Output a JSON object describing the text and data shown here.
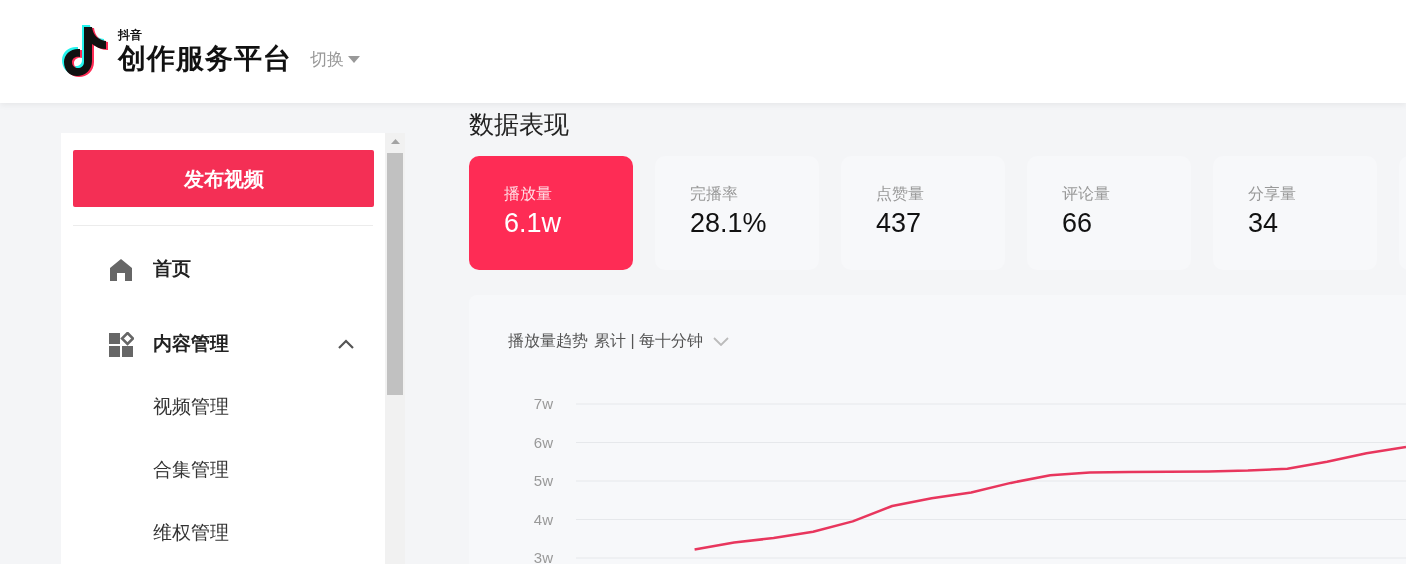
{
  "header": {
    "brand_small": "抖音",
    "brand": "创作服务平台",
    "switch": "切换"
  },
  "sidebar": {
    "publish_button": "发布视频",
    "items": [
      {
        "label": "首页",
        "kind": "home"
      },
      {
        "label": "内容管理",
        "kind": "content",
        "expanded": true,
        "children": [
          {
            "label": "视频管理"
          },
          {
            "label": "合集管理"
          },
          {
            "label": "维权管理"
          }
        ]
      }
    ]
  },
  "section_title": "数据表现",
  "stats": [
    {
      "label": "播放量",
      "value": "6.1w",
      "selected": true
    },
    {
      "label": "完播率",
      "value": "28.1%",
      "selected": false
    },
    {
      "label": "点赞量",
      "value": "437",
      "selected": false
    },
    {
      "label": "评论量",
      "value": "66",
      "selected": false
    },
    {
      "label": "分享量",
      "value": "34",
      "selected": false
    }
  ],
  "trend": {
    "title": "播放量趋势",
    "mode": "累计 | 每十分钟",
    "chart_data": {
      "type": "line",
      "grid": true,
      "ylim": [
        3,
        7
      ],
      "yticks": [
        {
          "value": 3,
          "label": "3w"
        },
        {
          "value": 4,
          "label": "4w"
        },
        {
          "value": 5,
          "label": "5w"
        },
        {
          "value": 6,
          "label": "6w"
        },
        {
          "value": 7,
          "label": "7w"
        }
      ],
      "series": [
        {
          "color": "#e8365d",
          "values": [
            null,
            null,
            null,
            3.22,
            3.4,
            3.52,
            3.68,
            3.95,
            4.35,
            4.55,
            4.7,
            4.95,
            5.15,
            5.22,
            5.23,
            5.24,
            5.25,
            5.27,
            5.32,
            5.5,
            5.72,
            5.88
          ]
        }
      ]
    }
  }
}
